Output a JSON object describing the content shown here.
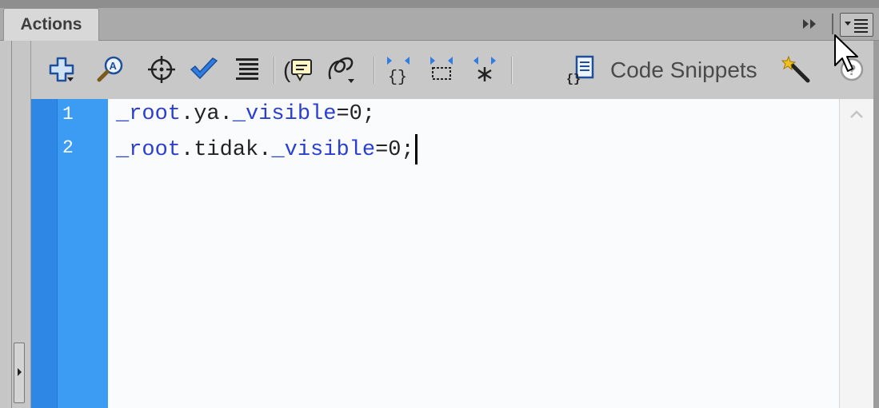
{
  "panel": {
    "tab_label": "Actions",
    "collapse_icon": "double-chevron-right-icon",
    "menu_icon": "panel-menu-icon"
  },
  "toolbar": {
    "tools": [
      {
        "name": "add-statement",
        "icon": "add-plus-icon"
      },
      {
        "name": "find",
        "icon": "find-magnifier-icon"
      },
      {
        "name": "insert-target-path",
        "icon": "target-crosshair-icon"
      },
      {
        "name": "check-syntax",
        "icon": "check-syntax-icon"
      },
      {
        "name": "auto-format",
        "icon": "auto-format-icon"
      },
      {
        "name": "show-code-hint",
        "icon": "code-hint-icon"
      },
      {
        "name": "debug-options",
        "icon": "debug-options-icon"
      },
      {
        "name": "collapse-between-braces",
        "icon": "collapse-braces-icon"
      },
      {
        "name": "collapse-selection",
        "icon": "collapse-selection-icon"
      },
      {
        "name": "expand-all",
        "icon": "expand-all-icon"
      }
    ],
    "code_snippets_label": "Code Snippets",
    "code_snippets_icon": "code-snippets-icon",
    "script_assist_icon": "script-assist-wand-icon",
    "help_icon": "help-icon"
  },
  "editor": {
    "line_numbers": [
      "1",
      "2"
    ],
    "lines": [
      {
        "obj": "_root",
        "dot1": ".",
        "target": "ya",
        "dot2": ".",
        "prop": "_visible",
        "rest": "=0;"
      },
      {
        "obj": "_root",
        "dot1": ".",
        "target": "tidak",
        "dot2": ".",
        "prop": "_visible",
        "rest": "=0;"
      }
    ]
  },
  "colors": {
    "gutter": "#3c9bf2",
    "keyword": "#2a3fd0",
    "editor_bg": "#fafbfd",
    "toolbar_bg": "#c8c8c8"
  }
}
